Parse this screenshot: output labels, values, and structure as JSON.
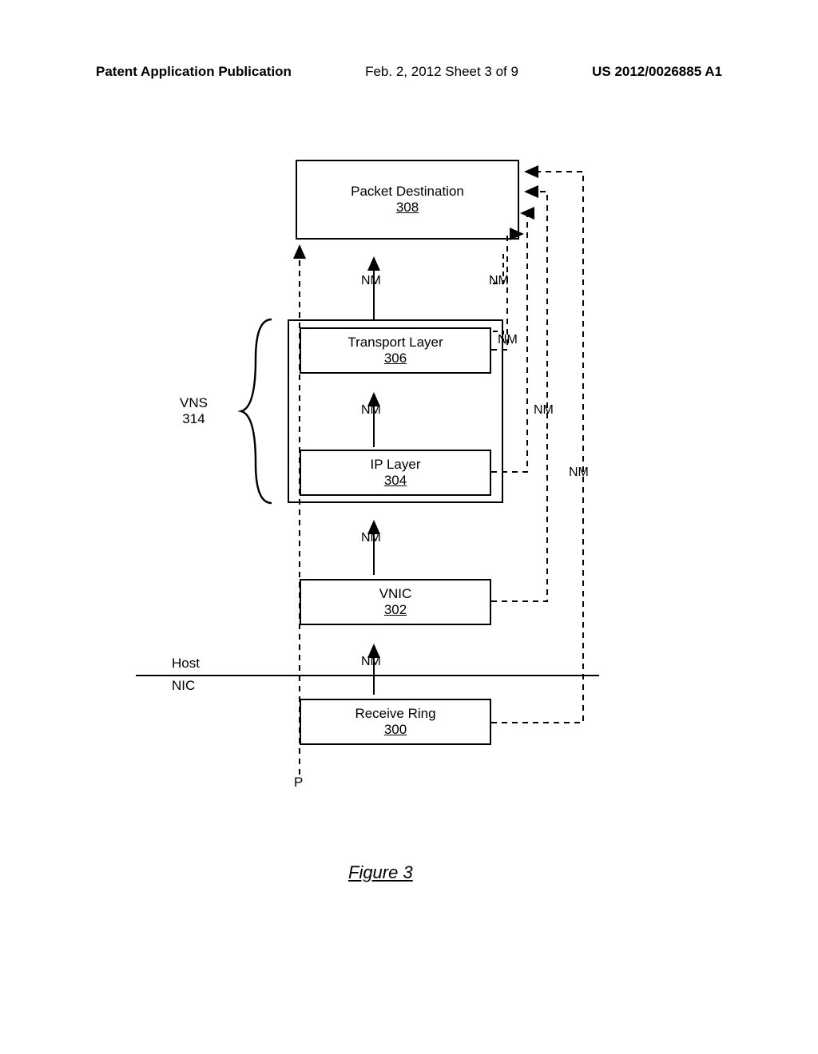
{
  "header": {
    "left": "Patent Application Publication",
    "center": "Feb. 2, 2012  Sheet 3 of 9",
    "right": "US 2012/0026885 A1"
  },
  "boxes": {
    "packetDest": {
      "title": "Packet Destination",
      "ref": "308"
    },
    "transport": {
      "title": "Transport Layer",
      "ref": "306"
    },
    "ip": {
      "title": "IP Layer",
      "ref": "304"
    },
    "vnic": {
      "title": "VNIC",
      "ref": "302"
    },
    "recv": {
      "title": "Receive Ring",
      "ref": "300"
    }
  },
  "labels": {
    "vns": "VNS",
    "vnsRef": "314",
    "host": "Host",
    "nic": "NIC",
    "nm": "NM",
    "p": "P",
    "figure": "Figure 3"
  }
}
